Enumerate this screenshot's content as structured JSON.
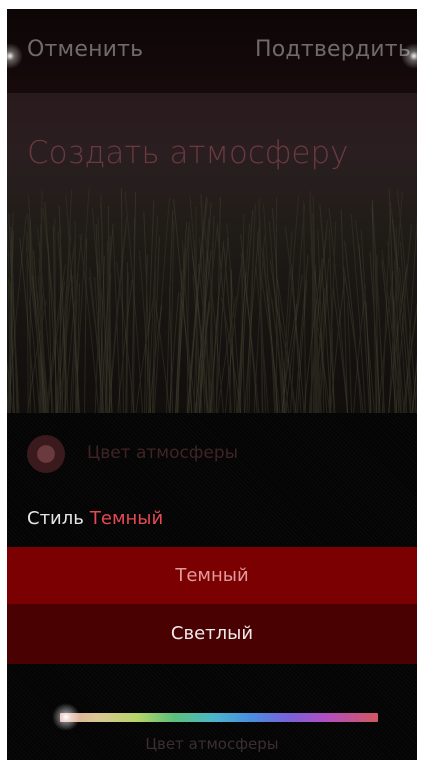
{
  "header": {
    "cancel_label": "Отменить",
    "confirm_label": "Подтвердить"
  },
  "hero": {
    "title": "Создать атмосферу"
  },
  "ambience": {
    "color_label": "Цвет атмосферы",
    "swatch_color": "#6a3a3e"
  },
  "style": {
    "key_label": "Стиль",
    "current_value": "Темный",
    "options": [
      {
        "label": "Темный",
        "selected": true
      },
      {
        "label": "Светлый",
        "selected": false
      }
    ]
  },
  "slider": {
    "label": "Цвет атмосферы",
    "position": 0.02
  },
  "colors": {
    "accent": "#e44a52",
    "selected_option_bg": "#7b0001",
    "option_bg": "#4a0102"
  }
}
